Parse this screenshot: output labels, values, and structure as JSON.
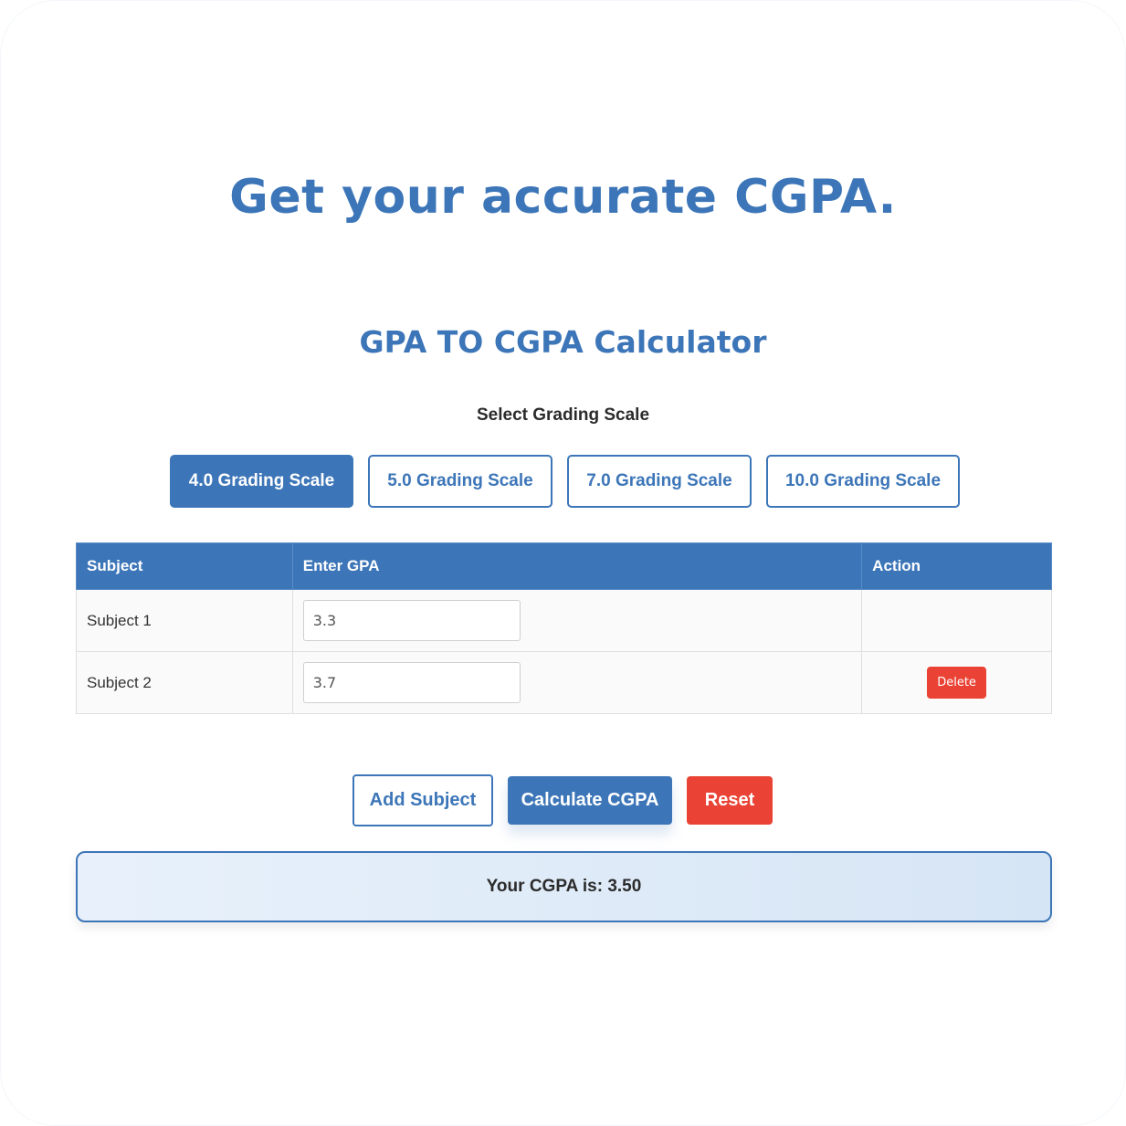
{
  "hero": {
    "title": "Get your accurate CGPA."
  },
  "calculator": {
    "title": "GPA TO CGPA Calculator",
    "scale_label": "Select Grading Scale",
    "scales": [
      {
        "label": "4.0 Grading Scale",
        "active": true
      },
      {
        "label": "5.0 Grading Scale",
        "active": false
      },
      {
        "label": "7.0 Grading Scale",
        "active": false
      },
      {
        "label": "10.0 Grading Scale",
        "active": false
      }
    ],
    "table": {
      "headers": [
        "Subject",
        "Enter GPA",
        "Action"
      ],
      "rows": [
        {
          "subject": "Subject 1",
          "gpa": "3.3",
          "action": ""
        },
        {
          "subject": "Subject 2",
          "gpa": "3.7",
          "action": "Delete"
        }
      ]
    },
    "buttons": {
      "add": "Add Subject",
      "calculate": "Calculate CGPA",
      "reset": "Reset"
    },
    "result": "Your CGPA is: 3.50"
  },
  "colors": {
    "accent": "#3d76b8",
    "danger": "#ea4335",
    "result_bg": "#e3edf8"
  }
}
